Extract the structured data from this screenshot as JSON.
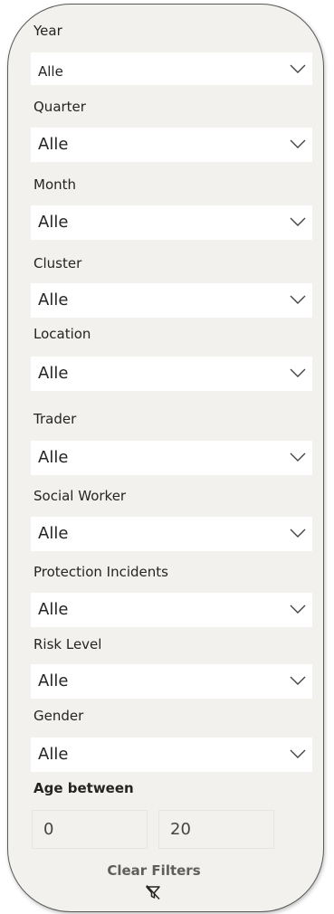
{
  "filters": [
    {
      "label": "Year",
      "value": "Alle"
    },
    {
      "label": "Quarter",
      "value": "Alle"
    },
    {
      "label": "Month",
      "value": "Alle"
    },
    {
      "label": "Cluster",
      "value": "Alle"
    },
    {
      "label": "Location",
      "value": "Alle"
    },
    {
      "label": "Trader",
      "value": "Alle"
    },
    {
      "label": "Social Worker",
      "value": "Alle"
    },
    {
      "label": "Protection Incidents",
      "value": "Alle"
    },
    {
      "label": "Risk Level",
      "value": "Alle"
    },
    {
      "label": "Gender",
      "value": "Alle"
    }
  ],
  "age": {
    "label": "Age between",
    "min": "0",
    "max": "20"
  },
  "clear_filters_label": "Clear Filters",
  "icons": {
    "dropdown": "chevron-down-icon",
    "clear": "filter-clear-icon"
  }
}
